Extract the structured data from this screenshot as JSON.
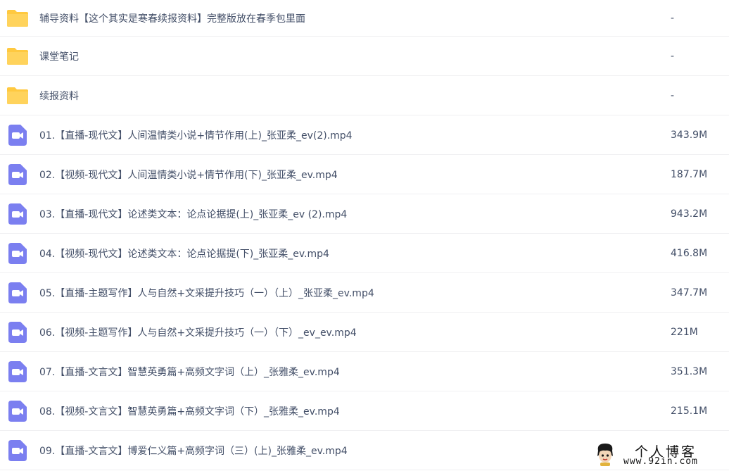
{
  "colors": {
    "folder": "#ffc940",
    "video_icon": "#7b7ff0",
    "text": "#424e67",
    "divider": "#f0f0f2"
  },
  "files": [
    {
      "type": "folder",
      "icon": "folder-icon",
      "name": "辅导资料【这个其实是寒春续报资料】完整版放在春季包里面",
      "size": "-"
    },
    {
      "type": "folder",
      "icon": "folder-icon",
      "name": "课堂笔记",
      "size": "-"
    },
    {
      "type": "folder",
      "icon": "folder-icon",
      "name": "续报资料",
      "size": "-"
    },
    {
      "type": "video",
      "icon": "video-file-icon",
      "name": "01.【直播-现代文】人间温情类小说+情节作用(上)_张亚柔_ev(2).mp4",
      "size": "343.9M"
    },
    {
      "type": "video",
      "icon": "video-file-icon",
      "name": "02.【视频-现代文】人间温情类小说+情节作用(下)_张亚柔_ev.mp4",
      "size": "187.7M"
    },
    {
      "type": "video",
      "icon": "video-file-icon",
      "name": "03.【直播-现代文】论述类文本：论点论据提(上)_张亚柔_ev (2).mp4",
      "size": "943.2M"
    },
    {
      "type": "video",
      "icon": "video-file-icon",
      "name": "04.【视频-现代文】论述类文本：论点论据提(下)_张亚柔_ev.mp4",
      "size": "416.8M"
    },
    {
      "type": "video",
      "icon": "video-file-icon",
      "name": "05.【直播-主题写作】人与自然+文采提升技巧（一）（上）_张亚柔_ev.mp4",
      "size": "347.7M"
    },
    {
      "type": "video",
      "icon": "video-file-icon",
      "name": "06.【视频-主题写作】人与自然+文采提升技巧（一）（下）_ev_ev.mp4",
      "size": "221M"
    },
    {
      "type": "video",
      "icon": "video-file-icon",
      "name": "07.【直播-文言文】智慧英勇篇+高频文字词（上）_张雅柔_ev.mp4",
      "size": "351.3M"
    },
    {
      "type": "video",
      "icon": "video-file-icon",
      "name": "08.【视频-文言文】智慧英勇篇+高频文字词（下）_张雅柔_ev.mp4",
      "size": "215.1M"
    },
    {
      "type": "video",
      "icon": "video-file-icon",
      "name": "09.【直播-文言文】博爱仁义篇+高频字词（三）(上)_张雅柔_ev.mp4",
      "size": ""
    }
  ],
  "watermark": {
    "title": "个人博客",
    "url": "www.92in.com"
  }
}
